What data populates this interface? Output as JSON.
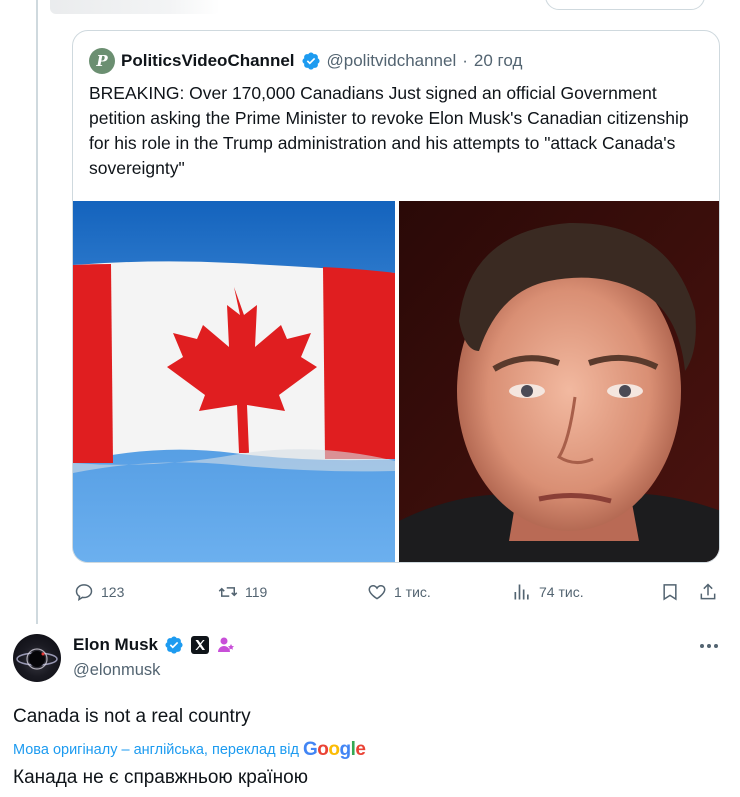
{
  "quoted_post": {
    "author_name": "PoliticsVideoChannel",
    "author_handle": "@politvidchannel",
    "separator": "·",
    "time": "20 год",
    "text": "BREAKING: Over 170,000 Canadians Just signed an official Government petition asking the Prime Minister to revoke Elon Musk's Canadian citizenship for his role in the Trump administration and his attempts to \"attack Canada's sovereignty\""
  },
  "actions": {
    "replies": "123",
    "reposts": "119",
    "likes": "1 тис.",
    "views": "74 тис."
  },
  "post": {
    "author_name": "Elon Musk",
    "author_handle": "@elonmusk",
    "text": "Canada is not a real country",
    "translation_note": "Мова оригіналу – англійська, переклад від",
    "translation_provider": "Google",
    "translated_text": "Канада не є справжньою країною"
  },
  "colors": {
    "verified": "#1d9bf0",
    "link": "#1d9bf0",
    "secondary_text": "#536471",
    "badge_purple": "#c84fd8"
  },
  "icons": [
    "reply-icon",
    "repost-icon",
    "like-icon",
    "views-icon",
    "bookmark-icon",
    "share-icon",
    "verified-icon",
    "x-affiliate-icon",
    "subscriber-icon",
    "more-icon"
  ]
}
